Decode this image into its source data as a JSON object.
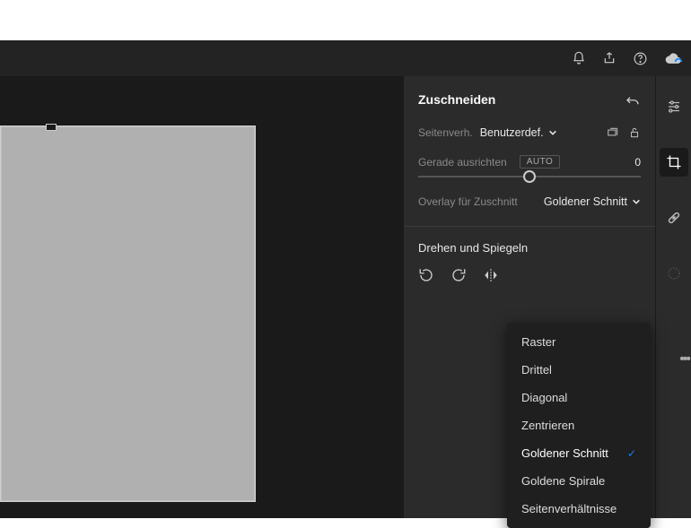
{
  "panel": {
    "title": "Zuschneiden",
    "aspect": {
      "label": "Seitenverh.",
      "value": "Benutzerdef."
    },
    "straighten": {
      "label": "Gerade ausrichten",
      "auto": "AUTO",
      "value": "0"
    },
    "overlay": {
      "label": "Overlay für Zuschnitt",
      "value": "Goldener Schnitt"
    },
    "rotateSection": "Drehen und Spiegeln"
  },
  "overlayMenu": {
    "items": [
      {
        "label": "Raster",
        "selected": false
      },
      {
        "label": "Drittel",
        "selected": false
      },
      {
        "label": "Diagonal",
        "selected": false
      },
      {
        "label": "Zentrieren",
        "selected": false
      },
      {
        "label": "Goldener Schnitt",
        "selected": true
      },
      {
        "label": "Goldene Spirale",
        "selected": false
      },
      {
        "label": "Seitenverhältnisse",
        "selected": false
      }
    ]
  }
}
